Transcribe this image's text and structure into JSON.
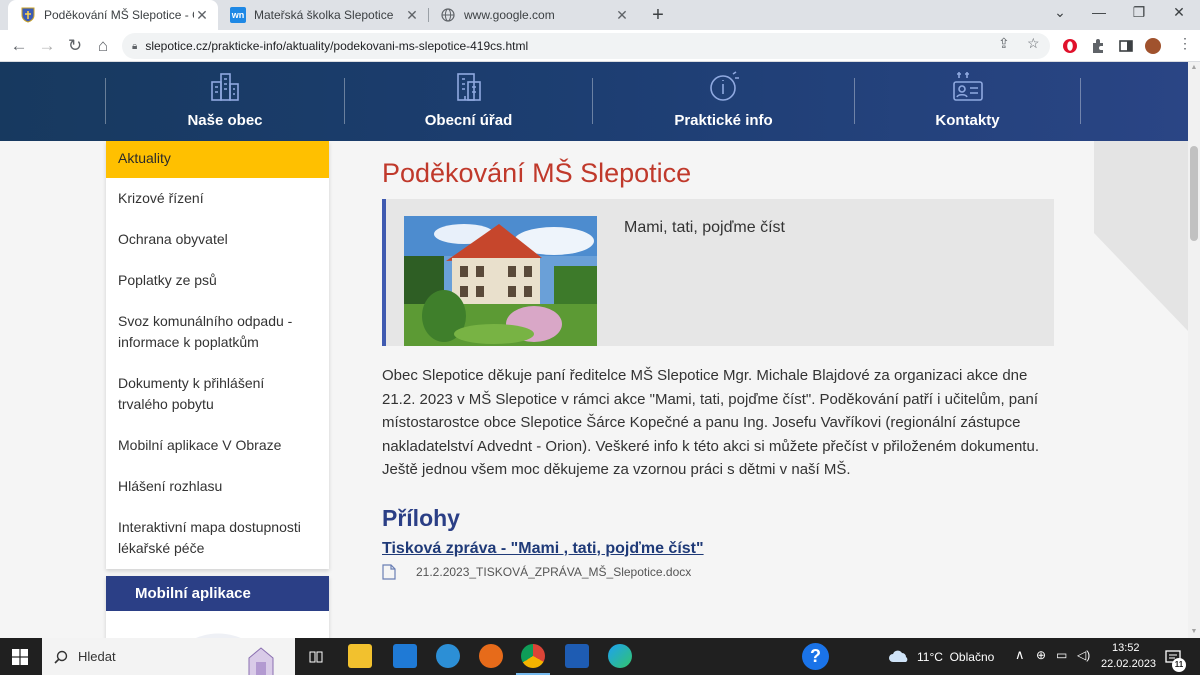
{
  "browser": {
    "tabs": [
      {
        "title": "Poděkování MŠ Slepotice - Oficiá",
        "active": true
      },
      {
        "title": "Mateřská školka Slepotice",
        "active": false
      },
      {
        "title": "www.google.com",
        "active": false
      }
    ],
    "favicon_wn": "wn",
    "url": "slepotice.cz/prakticke-info/aktuality/podekovani-ms-slepotice-419cs.html"
  },
  "site": {
    "nav": [
      "Naše obec",
      "Obecní úřad",
      "Praktické info",
      "Kontakty"
    ],
    "sidebar": [
      "Aktuality",
      "Krizové řízení",
      "Ochrana obyvatel",
      "Poplatky ze psů",
      "Svoz komunálního odpadu - informace k poplatkům",
      "Dokumenty k přihlášení trvalého pobytu",
      "Mobilní aplikace V Obraze",
      "Hlášení rozhlasu",
      "Interaktivní mapa dostupnosti lékařské péče"
    ],
    "mobile_box_title": "Mobilní aplikace",
    "article": {
      "title": "Poděkování MŠ Slepotice",
      "perex": "Mami, tati, pojďme číst",
      "body": "Obec Slepotice děkuje paní ředitelce MŠ Slepotice Mgr. Michale Blajdové  za organizaci akce dne 21.2. 2023 v MŠ Slepotice v rámci akce \"Mami, tati, pojďme číst\". Poděkování patří i učitelům, paní místostarostce obce Slepotice Šárce Kopečné a panu Ing. Josefu Vavříkovi (regionální zástupce nakladatelství Advednt - Orion). Veškeré info k této akci si můžete přečíst v přiloženém dokumentu. Ještě jednou všem moc děkujeme za vzornou práci s dětmi v naší MŠ.",
      "attachments_heading": "Přílohy",
      "attachment_link": "Tisková zpráva - \"Mami , tati, pojďme číst\"",
      "attachment_file": "21.2.2023_TISKOVÁ_ZPRÁVA_MŠ_Slepotice.docx"
    }
  },
  "taskbar": {
    "search_placeholder": "Hledat",
    "weather": "11°C  Oblačno",
    "time": "13:52",
    "date": "22.02.2023",
    "notifications": "11"
  },
  "colors": {
    "accent_yellow": "#ffc000",
    "title_red": "#c0392b",
    "nav_blue": "#1d3e72",
    "heading_blue": "#2b3f86"
  }
}
